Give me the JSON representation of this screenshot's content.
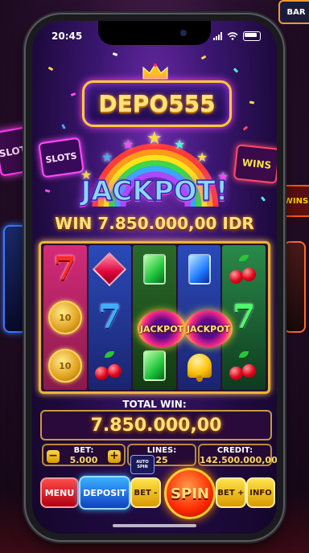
{
  "status_bar": {
    "time": "20:45"
  },
  "brand": {
    "logo_text": "DEPO555"
  },
  "signs": {
    "slots": "SLOTS",
    "wins": "WINS",
    "bar": "BAR"
  },
  "banner": {
    "jackpot_text": "JACKPOT!",
    "win_text": "WIN 7.850.000,00 IDR"
  },
  "reels": {
    "jackpot_badge_1": "JACKPOT",
    "jackpot_badge_2": "JACKPOT",
    "coin_label": "10"
  },
  "totals": {
    "total_win_label": "TOTAL WIN:",
    "total_win_value": "7.850.000,00"
  },
  "bet_panel": {
    "bet_label": "BET:",
    "bet_value": "5.000",
    "minus": "−",
    "plus": "+",
    "lines_label": "LINES:",
    "lines_value": "25",
    "credit_label": "CREDIT:",
    "credit_value": "142.500.000,00"
  },
  "controls": {
    "menu": "MENU",
    "deposit": "DEPOSIT",
    "bet_minus": "BET -",
    "auto_spin": "AUTO SPIN",
    "spin": "SPIN",
    "bet_plus": "BET +",
    "info": "INFO"
  },
  "colors": {
    "accent_gold": "#ffcc33",
    "spin_red": "#ff2a00",
    "deposit_blue": "#1e7aff",
    "menu_red": "#e0001a"
  },
  "icons": [
    "signal-icon",
    "wifi-icon",
    "battery-icon",
    "crown-icon",
    "star-icon",
    "seven-icon",
    "coin-icon",
    "gem-icon",
    "cherry-icon",
    "bell-icon"
  ]
}
